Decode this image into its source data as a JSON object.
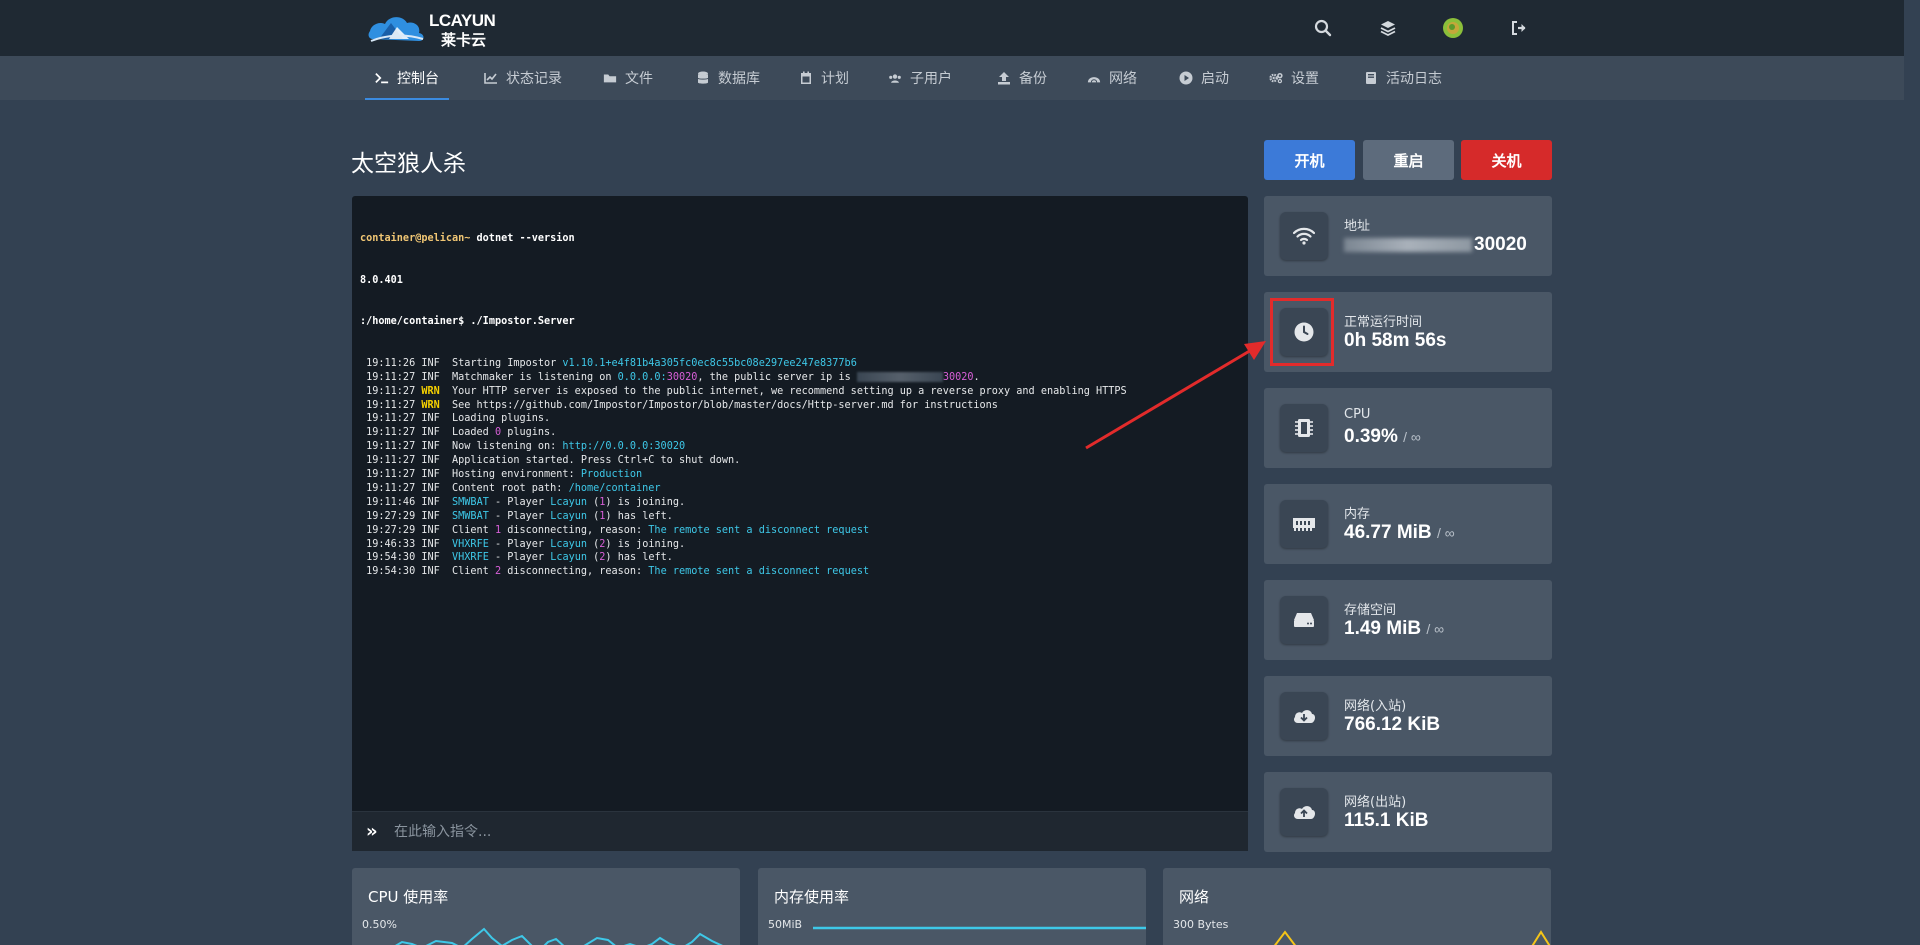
{
  "brand": {
    "name": "LCAYUN",
    "subtitle": "莱卡云"
  },
  "nav": {
    "items": [
      {
        "label": "控制台",
        "icon": "terminal-icon",
        "active": true
      },
      {
        "label": "状态记录",
        "icon": "chart-line-icon"
      },
      {
        "label": "文件",
        "icon": "folder-icon"
      },
      {
        "label": "数据库",
        "icon": "database-icon"
      },
      {
        "label": "计划",
        "icon": "calendar-icon"
      },
      {
        "label": "子用户",
        "icon": "users-icon"
      },
      {
        "label": "备份",
        "icon": "upload-icon"
      },
      {
        "label": "网络",
        "icon": "network-icon"
      },
      {
        "label": "启动",
        "icon": "play-icon"
      },
      {
        "label": "设置",
        "icon": "cogs-icon"
      },
      {
        "label": "活动日志",
        "icon": "book-icon"
      }
    ]
  },
  "server": {
    "name": "太空狼人杀"
  },
  "controls": {
    "start": "开机",
    "restart": "重启",
    "stop": "关机"
  },
  "console": {
    "prompt_user": "container@pelican~",
    "cmd1": " dotnet --version",
    "dotnet_version": "8.0.401",
    "prompt_path": ":/home/container$",
    "cmd2": " ./Impostor.Server",
    "placeholder": "在此输入指令...",
    "log": [
      {
        "t": " 19:11:26 ",
        "lvl": "INF",
        "pre": "  Starting Impostor ",
        "hl": "v1.10.1+e4f81b4a305fc0ec8c55bc08e297ee247e8377b6",
        "post": ""
      },
      {
        "t": " 19:11:27 ",
        "lvl": "INF",
        "special": "matchmaker"
      },
      {
        "t": " 19:11:27 ",
        "lvl": "WRN",
        "pre": "  Your HTTP server is exposed to the public internet, we recommend setting up a reverse proxy and enabling HTTPS",
        "hl": "",
        "post": ""
      },
      {
        "t": " 19:11:27 ",
        "lvl": "WRN",
        "pre": "  See https://github.com/Impostor/Impostor/blob/master/docs/Http-server.md for instructions",
        "hl": "",
        "post": ""
      },
      {
        "t": " 19:11:27 ",
        "lvl": "INF",
        "pre": "  Loading plugins.",
        "hl": "",
        "post": ""
      },
      {
        "t": " 19:11:27 ",
        "lvl": "INF",
        "pre": "  Loaded ",
        "hl": "0",
        "post": " plugins."
      },
      {
        "t": " 19:11:27 ",
        "lvl": "INF",
        "pre": "  Now listening on: ",
        "hl": "http://0.0.0.0:30020",
        "post": ""
      },
      {
        "t": " 19:11:27 ",
        "lvl": "INF",
        "pre": "  Application started. Press Ctrl+C to shut down.",
        "hl": "",
        "post": ""
      },
      {
        "t": " 19:11:27 ",
        "lvl": "INF",
        "pre": "  Hosting environment: ",
        "hl": "Production",
        "post": ""
      },
      {
        "t": " 19:11:27 ",
        "lvl": "INF",
        "pre": "  Content root path: ",
        "hl": "/home/container",
        "post": ""
      },
      {
        "t": " 19:11:46 ",
        "lvl": "INF",
        "special": "player",
        "code": "SMWBAT",
        "player": "Lcayun",
        "num": "1",
        "action": ") is joining."
      },
      {
        "t": " 19:27:29 ",
        "lvl": "INF",
        "special": "player",
        "code": "SMWBAT",
        "player": "Lcayun",
        "num": "1",
        "action": ") has left."
      },
      {
        "t": " 19:27:29 ",
        "lvl": "INF",
        "special": "client",
        "num": "1"
      },
      {
        "t": " 19:46:33 ",
        "lvl": "INF",
        "special": "player",
        "code": "VHXRFE",
        "player": "Lcayun",
        "num": "2",
        "action": ") is joining."
      },
      {
        "t": " 19:54:30 ",
        "lvl": "INF",
        "special": "player",
        "code": "VHXRFE",
        "player": "Lcayun",
        "num": "2",
        "action": ") has left."
      },
      {
        "t": " 19:54:30 ",
        "lvl": "INF",
        "special": "client",
        "num": "2"
      }
    ],
    "matchmaker_pre": "  Matchmaker is listening on ",
    "matchmaker_ip": "0.0.0.0:",
    "matchmaker_port": "30020",
    "matchmaker_mid": ", the public server ip is ",
    "matchmaker_port2": "30020",
    "client_pre": "  Client ",
    "client_mid": " disconnecting, reason: ",
    "client_reason": "The remote sent a disconnect request",
    "player_sep": " - Player ",
    "player_open": " ("
  },
  "stats": {
    "address": {
      "label": "地址",
      "value": "30020"
    },
    "uptime": {
      "label": "正常运行时间",
      "value": "0h 58m 56s"
    },
    "cpu": {
      "label": "CPU",
      "value": "0.39%",
      "limit": "/ ∞"
    },
    "memory": {
      "label": "内存",
      "value": "46.77 MiB",
      "limit": "/ ∞"
    },
    "storage": {
      "label": "存储空间",
      "value": "1.49 MiB",
      "limit": "/ ∞"
    },
    "net_in": {
      "label": "网络(入站)",
      "value": "766.12 KiB"
    },
    "net_out": {
      "label": "网络(出站)",
      "value": "115.1 KiB"
    }
  },
  "graphs": {
    "cpu": {
      "title": "CPU 使用率",
      "ymax": "0.50%"
    },
    "memory": {
      "title": "内存使用率",
      "ymax": "50MiB"
    },
    "network": {
      "title": "网络",
      "ymax": "300 Bytes"
    }
  },
  "colors": {
    "accent": "#3b8be0",
    "start": "#3c7ad8",
    "stop": "#d62a2a",
    "highlight": "#e22b2b",
    "graph_line": "#3ec8e8",
    "graph_yellow": "#f5c518"
  }
}
